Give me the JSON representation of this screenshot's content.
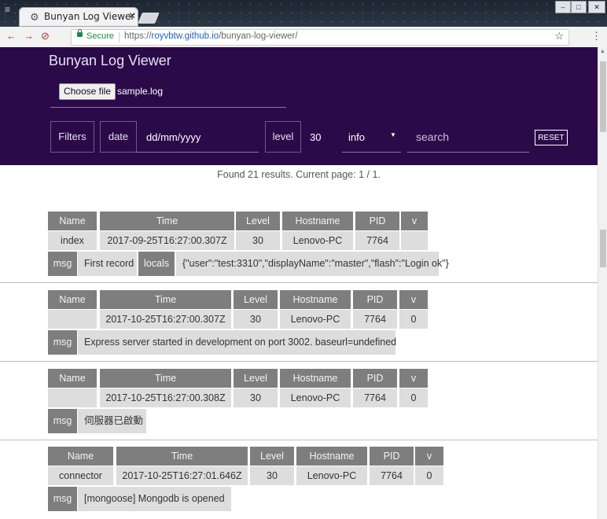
{
  "browser": {
    "tab_title": "Bunyan Log Viewer",
    "secure_label": "Secure",
    "url_scheme": "https://",
    "url_host": "royvbtw.github.io",
    "url_path": "/bunyan-log-viewer/"
  },
  "app": {
    "title": "Bunyan Log Viewer",
    "choose_file_label": "Choose file",
    "file_name": "sample.log"
  },
  "filters": {
    "filters_label": "Filters",
    "date_label": "date",
    "date_placeholder": "dd/mm/yyyy",
    "level_label": "level",
    "level_value": "30",
    "level_select": "info",
    "search_placeholder": "search",
    "reset_label": "RESET"
  },
  "results": {
    "summary": "Found 21 results. Current page: 1 / 1.",
    "headers": [
      "Name",
      "Time",
      "Level",
      "Hostname",
      "PID",
      "v"
    ],
    "records": [
      {
        "row": [
          "index",
          "2017-09-25T16:27:00.307Z",
          "30",
          "Lenovo-PC",
          "7764",
          ""
        ],
        "fields": [
          {
            "key": "msg",
            "value": "First record"
          },
          {
            "key": "locals",
            "value": "{\"user\":\"test:3310\",\"displayName\":\"master\",\"flash\":\"Login ok\"}"
          }
        ]
      },
      {
        "row": [
          "",
          "2017-10-25T16:27:00.307Z",
          "30",
          "Lenovo-PC",
          "7764",
          "0"
        ],
        "fields": [
          {
            "key": "msg",
            "value": "Express server started in development on port 3002. baseurl=undefined"
          }
        ]
      },
      {
        "row": [
          "",
          "2017-10-25T16:27:00.308Z",
          "30",
          "Lenovo-PC",
          "7764",
          "0"
        ],
        "fields": [
          {
            "key": "msg",
            "value": "伺服器已啟動"
          }
        ]
      },
      {
        "row": [
          "connector",
          "2017-10-25T16:27:01.646Z",
          "30",
          "Lenovo-PC",
          "7764",
          "0"
        ],
        "fields": [
          {
            "key": "msg",
            "value": "[mongoose] Mongodb is opened"
          }
        ]
      }
    ]
  }
}
